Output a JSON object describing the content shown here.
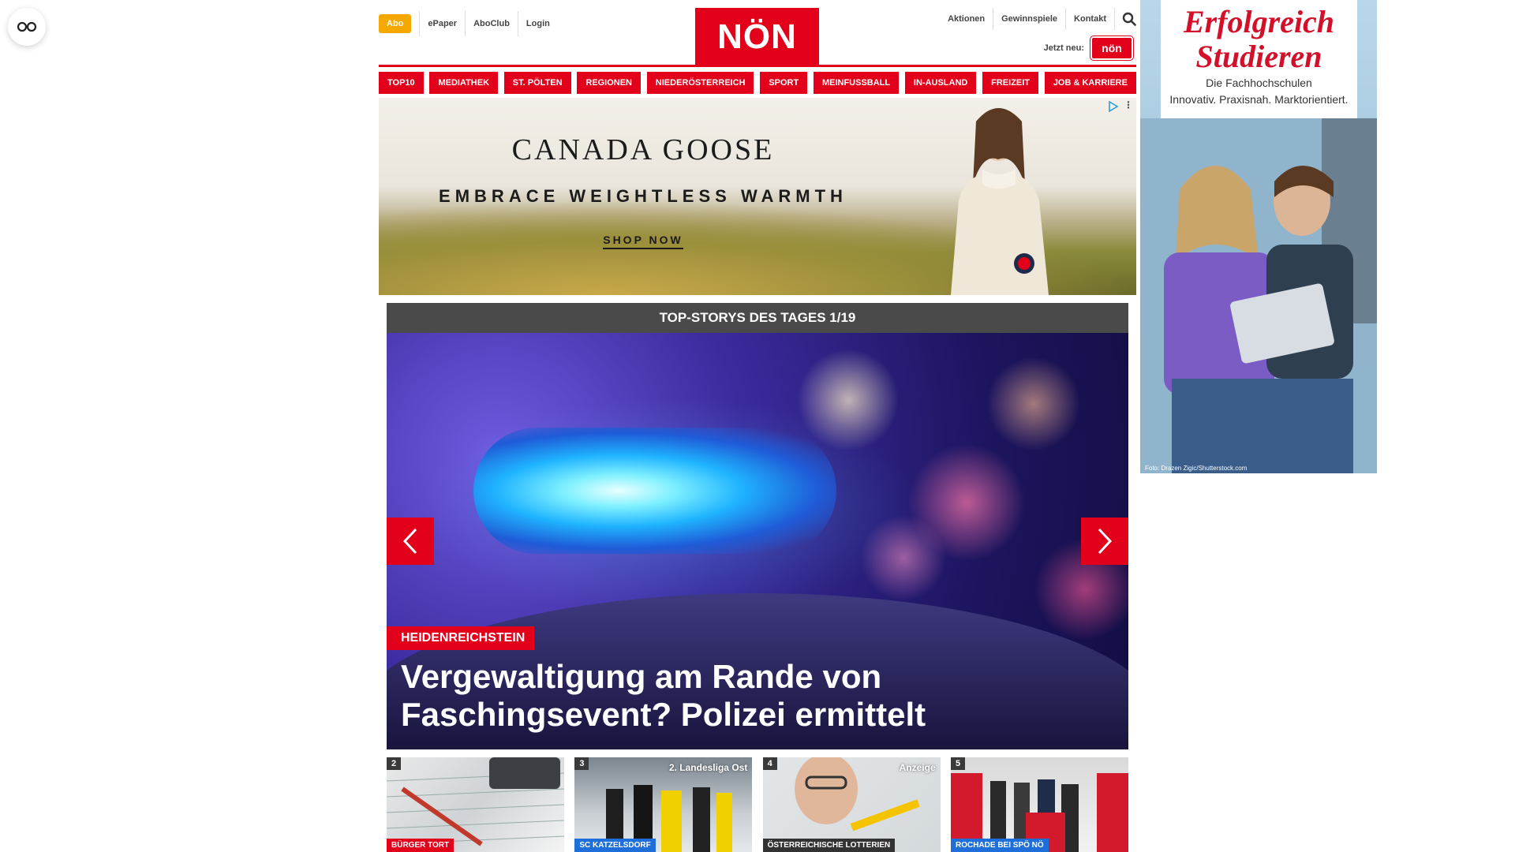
{
  "header": {
    "abo": "Abo",
    "links_left": [
      "ePaper",
      "AboClub",
      "Login"
    ],
    "logo": "NÖN",
    "links_right": [
      "Aktionen",
      "Gewinnspiele",
      "Kontakt"
    ],
    "jetzt_neu": "Jetzt neu:",
    "mini_logo": "nön"
  },
  "nav": {
    "items": [
      "TOP10",
      "MEDIATHEK",
      "ST. PÖLTEN",
      "REGIONEN",
      "NIEDERÖSTERREICH",
      "SPORT",
      "MEINFUSSBALL",
      "IN-AUSLAND",
      "FREIZEIT",
      "JOB & KARRIERE"
    ]
  },
  "ad_banner": {
    "brand": "CANADA GOOSE",
    "tagline": "EMBRACE WEIGHTLESS WARMTH",
    "cta": "SHOP NOW"
  },
  "top_stories": {
    "heading": "TOP-STORYS DES TAGES 1/19",
    "hero": {
      "category": "HEIDENREICHSTEIN",
      "title": "Vergewaltigung am Rande von Faschingsevent? Polizei ermittelt"
    },
    "thumbs": [
      {
        "num": "2",
        "tag": "",
        "category": "BÜRGER TORT"
      },
      {
        "num": "3",
        "tag": "2. Landesliga Ost",
        "category": "SC KATZELSDORF"
      },
      {
        "num": "4",
        "tag": "Anzeige",
        "category": "ÖSTERREICHISCHE LOTTERIEN"
      },
      {
        "num": "5",
        "tag": "",
        "category": "ROCHADE BEI SPÖ NÖ"
      }
    ]
  },
  "sky_ad": {
    "title": "Erfolgreich Studieren",
    "line1": "Die Fachhochschulen",
    "line2": "Innovativ. Praxisnah. Marktorientiert.",
    "credit": "Foto: Drazen Zigic/Shutterstock.com"
  },
  "colors": {
    "brand_red": "#e2001a",
    "abo_orange": "#f5a800",
    "stories_header": "#4a4a4a"
  }
}
